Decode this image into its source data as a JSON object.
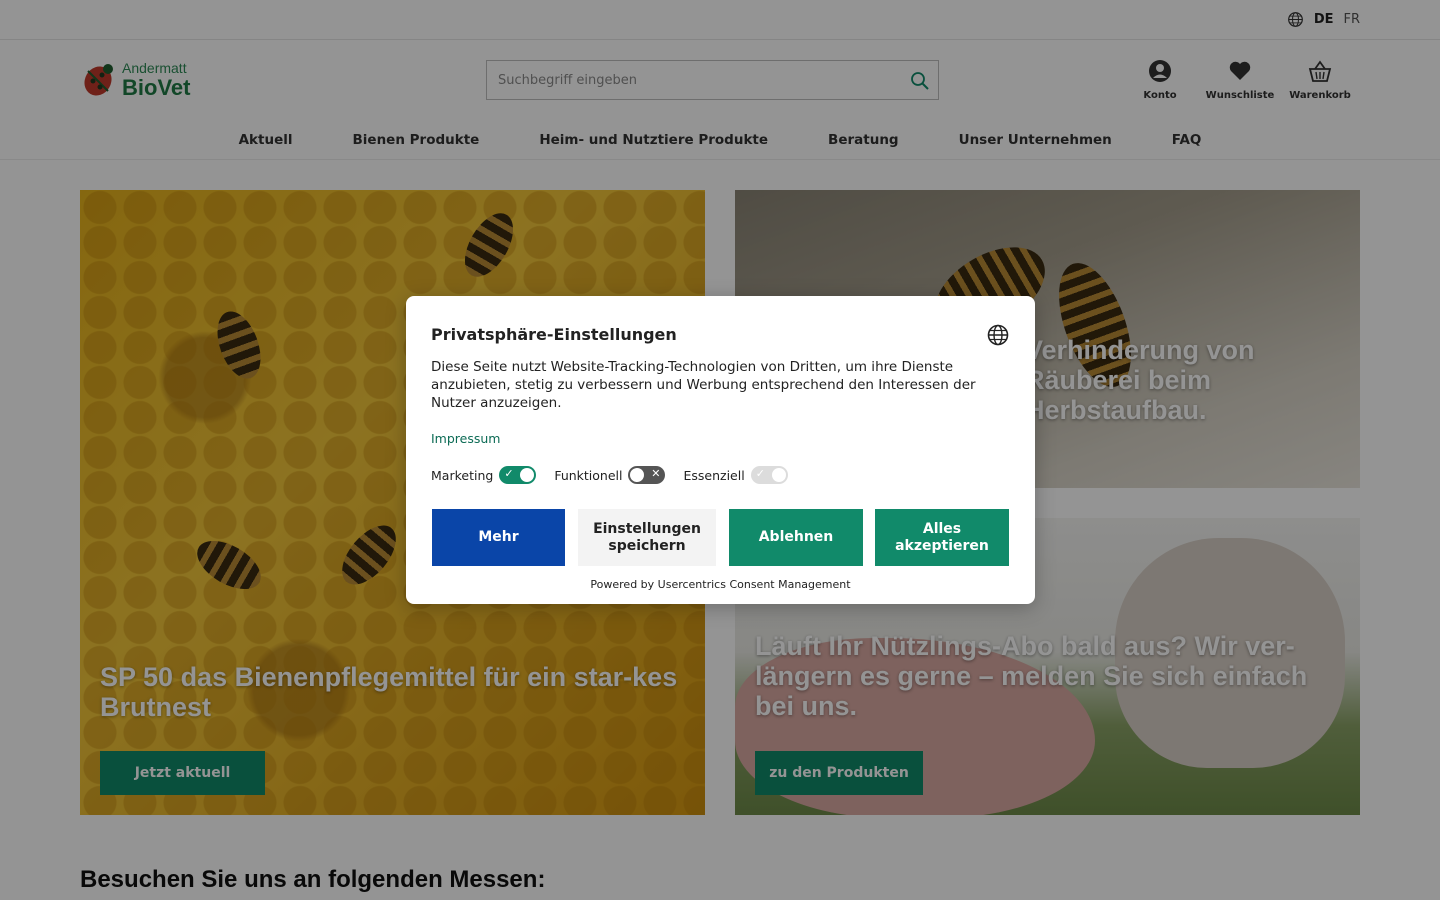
{
  "header": {
    "languages": [
      {
        "code": "DE",
        "active": true
      },
      {
        "code": "FR",
        "active": false
      }
    ],
    "logo": {
      "small": "Andermatt",
      "big": "BioVet"
    },
    "search": {
      "placeholder": "Suchbegriff eingeben"
    },
    "icons": [
      {
        "label": "Konto",
        "icon": "account-icon"
      },
      {
        "label": "Wunschliste",
        "icon": "heart-icon"
      },
      {
        "label": "Warenkorb",
        "icon": "basket-icon"
      }
    ],
    "nav": [
      "Aktuell",
      "Bienen Produkte",
      "Heim- und Nutztiere Produkte",
      "Beratung",
      "Unser Unternehmen",
      "FAQ"
    ]
  },
  "tiles": {
    "left": {
      "title": "SP 50 das Bienenpflegemittel für ein star-kes Brutnest",
      "button": "Jetzt aktuell"
    },
    "right_top": {
      "title": "Verhinderung von Räuberei beim Herbstaufbau."
    },
    "right_bottom": {
      "title": "Läuft Ihr Nützlings-Abo bald aus? Wir ver-längern es gerne – melden Sie sich einfach bei uns.",
      "button": "zu den Produkten"
    }
  },
  "section": {
    "title": "Besuchen Sie uns an folgenden Messen:"
  },
  "consent": {
    "title": "Privatsphäre-Einstellungen",
    "description": "Diese Seite nutzt Website-Tracking-Technologien von Dritten, um ihre Dienste anzubieten, stetig zu verbessern und Werbung entsprechend den Interessen der Nutzer anzuzeigen.",
    "impressum": "Impressum",
    "toggles": [
      {
        "label": "Marketing",
        "state": "on"
      },
      {
        "label": "Funktionell",
        "state": "off"
      },
      {
        "label": "Essenziell",
        "state": "disabled-on"
      }
    ],
    "buttons": {
      "more": "Mehr",
      "save": "Einstellungen speichern",
      "deny": "Ablehnen",
      "accept": "Alles akzeptieren"
    },
    "powered_by": "Powered by Usercentrics Consent Management"
  },
  "colors": {
    "brand_green": "#118a6a",
    "more_blue": "#0a45a8",
    "logo_green": "#1f7a45"
  }
}
